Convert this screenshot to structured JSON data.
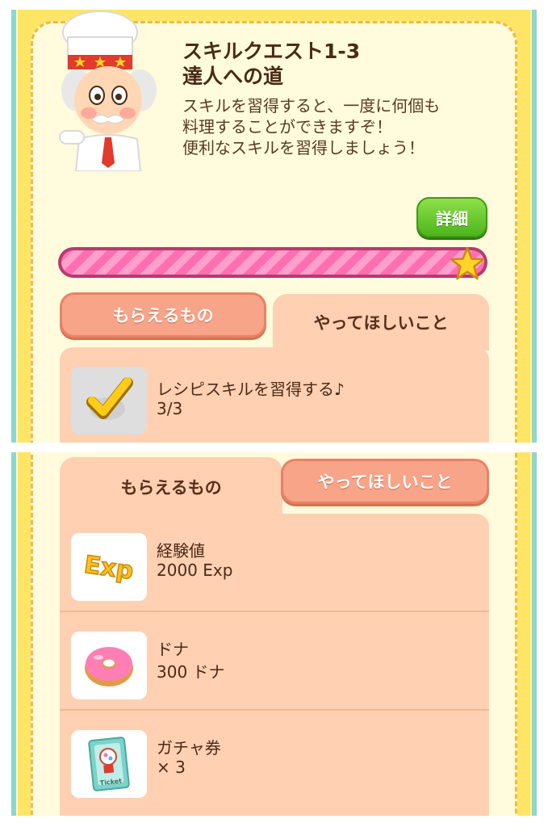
{
  "quest": {
    "title_line1": "スキルクエスト1-3",
    "title_line2": "達人への道",
    "desc_line1": "スキルを習得すると、一度に何個も",
    "desc_line2": "料理することができますぞ！",
    "desc_line3": "便利なスキルを習得しましょう！",
    "details_label": "詳細",
    "progress": 1.0
  },
  "tabs": {
    "rewards_label": "もらえるもの",
    "tasks_label": "やってほしいこと"
  },
  "task": {
    "name": "レシピスキルを習得する♪",
    "count": "3/3",
    "icon": "checkmark-icon"
  },
  "rewards": [
    {
      "name": "経験値",
      "value": "2000 Exp",
      "icon": "exp-icon",
      "icon_text": "Exp"
    },
    {
      "name": "ドナ",
      "value": "300 ドナ",
      "icon": "donut-icon"
    },
    {
      "name": "ガチャ券",
      "value": "× 3",
      "icon": "gacha-ticket-icon",
      "icon_text": "Ticket"
    }
  ],
  "colors": {
    "tab_active": "#ffd0b2",
    "tab_inactive": "#f7a489",
    "progress_fill": "#ff6eb0",
    "button_green": "#4db51c"
  }
}
